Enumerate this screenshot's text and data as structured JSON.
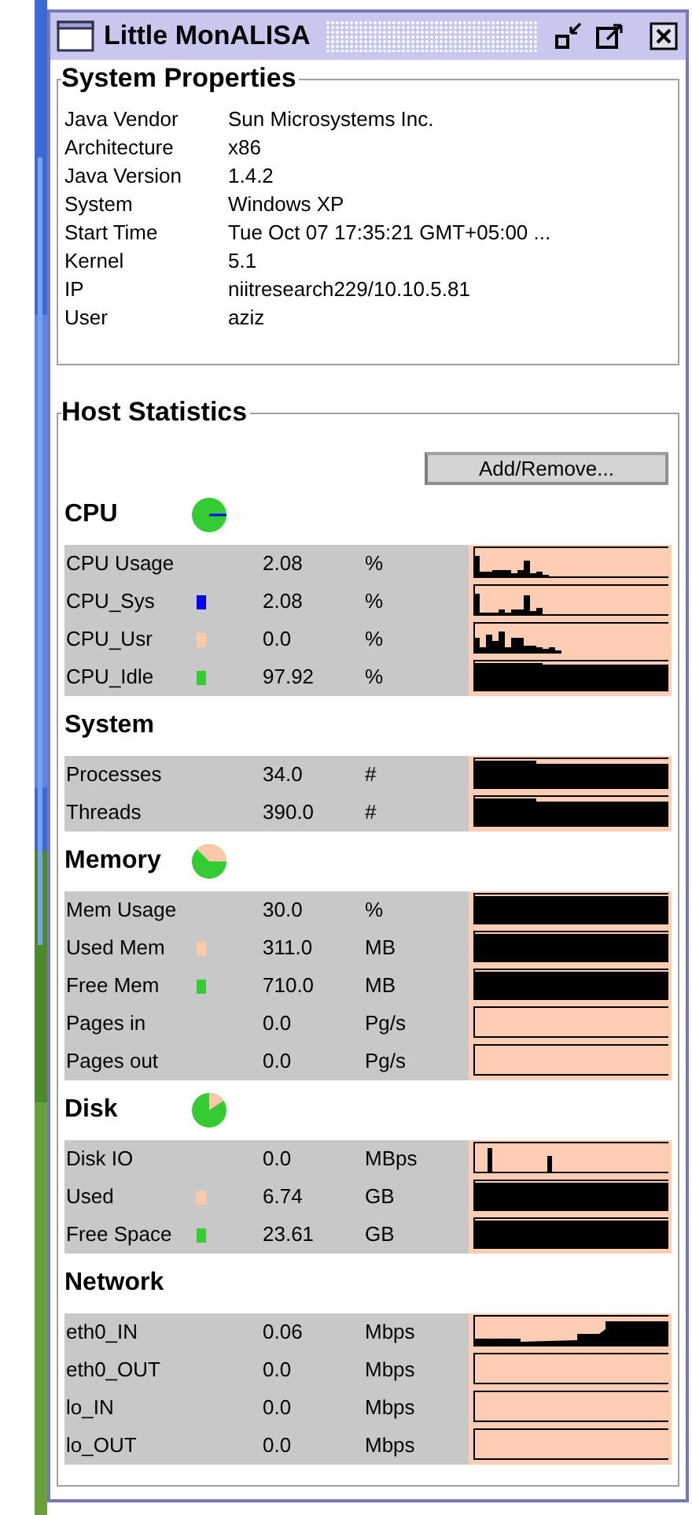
{
  "window": {
    "title": "Little MonALISA"
  },
  "system_properties": {
    "title": "System Properties",
    "rows": [
      {
        "label": "Java Vendor",
        "value": "Sun Microsystems Inc."
      },
      {
        "label": "Architecture",
        "value": "x86"
      },
      {
        "label": "Java Version",
        "value": "1.4.2"
      },
      {
        "label": "System",
        "value": "Windows XP"
      },
      {
        "label": "Start Time",
        "value": "Tue Oct 07 17:35:21 GMT+05:00 ..."
      },
      {
        "label": "Kernel",
        "value": "5.1"
      },
      {
        "label": "IP",
        "value": "niitresearch229/10.10.5.81"
      },
      {
        "label": "User",
        "value": "aziz"
      }
    ]
  },
  "host_statistics": {
    "title": "Host Statistics",
    "add_remove_button": "Add/Remove...",
    "sections": [
      {
        "title": "CPU",
        "kind": "cpu",
        "rows": [
          {
            "label": "CPU Usage",
            "value": "2.08",
            "unit": "%",
            "kind": "bars1"
          },
          {
            "label": "CPU_Sys",
            "color": "#0000ff",
            "value": "2.08",
            "unit": "%",
            "kind": "bars2"
          },
          {
            "label": "CPU_Usr",
            "color": "#ffc8a8",
            "value": "0.0",
            "unit": "%",
            "kind": "bars3"
          },
          {
            "label": "CPU_Idle",
            "color": "#33cc33",
            "value": "97.92",
            "unit": "%",
            "kind": "dip"
          }
        ]
      },
      {
        "title": "System",
        "kind": "plain",
        "rows": [
          {
            "label": "Processes",
            "value": "34.0",
            "unit": "#",
            "kind": "step"
          },
          {
            "label": "Threads",
            "value": "390.0",
            "unit": "#",
            "kind": "step"
          }
        ]
      },
      {
        "title": "Memory",
        "kind": "memory",
        "rows": [
          {
            "label": "Mem Usage",
            "value": "30.0",
            "unit": "%",
            "kind": "full"
          },
          {
            "label": "Used Mem",
            "color": "#ffc8a8",
            "value": "311.0",
            "unit": "MB",
            "kind": "full"
          },
          {
            "label": "Free Mem",
            "color": "#33cc33",
            "value": "710.0",
            "unit": "MB",
            "kind": "full"
          },
          {
            "label": "Pages in",
            "value": "0.0",
            "unit": "Pg/s",
            "kind": "empty"
          },
          {
            "label": "Pages out",
            "value": "0.0",
            "unit": "Pg/s",
            "kind": "empty"
          }
        ]
      },
      {
        "title": "Disk",
        "kind": "disk",
        "rows": [
          {
            "label": "Disk IO",
            "value": "0.0",
            "unit": "MBps",
            "kind": "spikes"
          },
          {
            "label": "Used",
            "color": "#ffc8a8",
            "value": "6.74",
            "unit": "GB",
            "kind": "full"
          },
          {
            "label": "Free Space",
            "color": "#33cc33",
            "value": "23.61",
            "unit": "GB",
            "kind": "full"
          }
        ]
      },
      {
        "title": "Network",
        "kind": "plain",
        "rows": [
          {
            "label": "eth0_IN",
            "value": "0.06",
            "unit": "Mbps",
            "kind": "rising"
          },
          {
            "label": "eth0_OUT",
            "value": "0.0",
            "unit": "Mbps",
            "kind": "empty"
          },
          {
            "label": "lo_IN",
            "value": "0.0",
            "unit": "Mbps",
            "kind": "empty"
          },
          {
            "label": "lo_OUT",
            "value": "0.0",
            "unit": "Mbps",
            "kind": "empty"
          }
        ]
      }
    ]
  }
}
